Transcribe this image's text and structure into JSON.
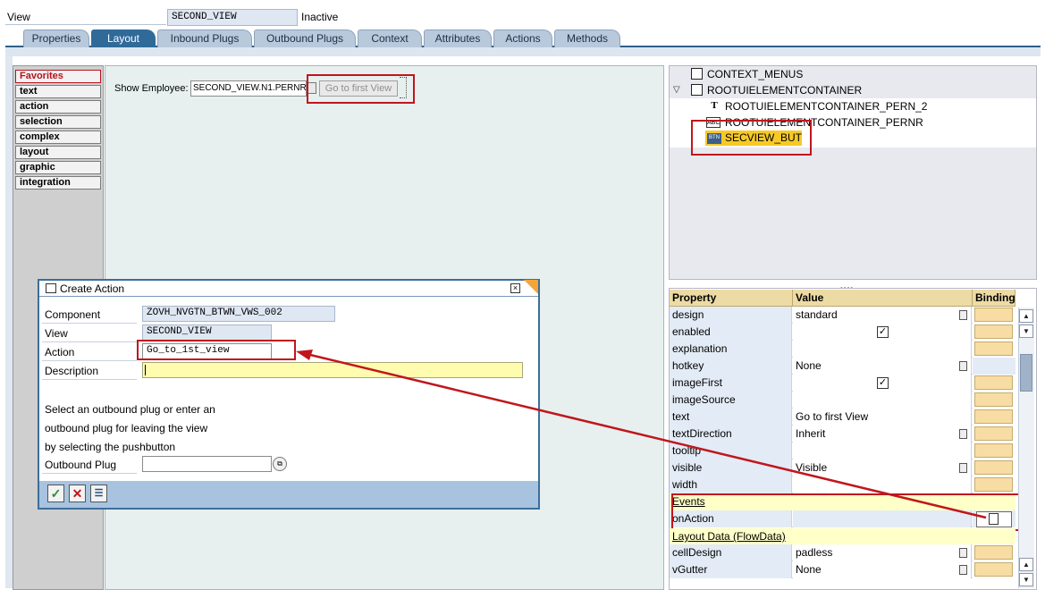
{
  "header": {
    "label": "View",
    "view_name": "SECOND_VIEW",
    "status": "Inactive"
  },
  "tabs": [
    "Properties",
    "Layout",
    "Inbound Plugs",
    "Outbound Plugs",
    "Context",
    "Attributes",
    "Actions",
    "Methods"
  ],
  "active_tab": "Layout",
  "palette": [
    "Favorites",
    "text",
    "action",
    "selection",
    "complex",
    "layout",
    "graphic",
    "integration"
  ],
  "canvas": {
    "label": "Show Employee:",
    "input_value": "SECOND_VIEW.N1.PERNR",
    "button_text": "Go to first View"
  },
  "tree": {
    "nodes": [
      "CONTEXT_MENUS",
      "ROOTUIELEMENTCONTAINER",
      "ROOTUIELEMENTCONTAINER_PERN_2",
      "ROOTUIELEMENTCONTAINER_PERNR",
      "SECVIEW_BUT"
    ],
    "icons": {
      "textview": "T",
      "inputfield": "ABC",
      "button": "BTN"
    }
  },
  "properties": {
    "headers": {
      "property": "Property",
      "value": "Value",
      "binding": "Binding"
    },
    "rows": [
      {
        "name": "design",
        "value": "standard"
      },
      {
        "name": "enabled",
        "value": ""
      },
      {
        "name": "explanation",
        "value": ""
      },
      {
        "name": "hotkey",
        "value": "None"
      },
      {
        "name": "imageFirst",
        "value": ""
      },
      {
        "name": "imageSource",
        "value": ""
      },
      {
        "name": "text",
        "value": "Go to first View"
      },
      {
        "name": "textDirection",
        "value": "Inherit"
      },
      {
        "name": "tooltip",
        "value": ""
      },
      {
        "name": "visible",
        "value": "Visible"
      },
      {
        "name": "width",
        "value": ""
      }
    ],
    "events_section": "Events",
    "event_row": {
      "name": "onAction",
      "value": ""
    },
    "layout_section": "Layout Data (FlowData)",
    "layout_rows": [
      {
        "name": "cellDesign",
        "value": "padless"
      },
      {
        "name": "vGutter",
        "value": "None"
      }
    ]
  },
  "dialog": {
    "title": "Create Action",
    "component_label": "Component",
    "component_value": "ZOVH_NVGTN_BTWN_VWS_002",
    "view_label": "View",
    "view_value": "SECOND_VIEW",
    "action_label": "Action",
    "action_value": "Go_to_1st_view",
    "description_label": "Description",
    "description_value": "",
    "help_line1": "Select an outbound plug or enter an",
    "help_line2": "outbound plug for leaving the view",
    "help_line3": "by selecting the pushbutton",
    "plug_label": "Outbound Plug",
    "plug_value": ""
  },
  "colors": {
    "tab_active": "#2f6a99",
    "highlight": "#f7c928",
    "annotation_red": "#c0161c"
  }
}
